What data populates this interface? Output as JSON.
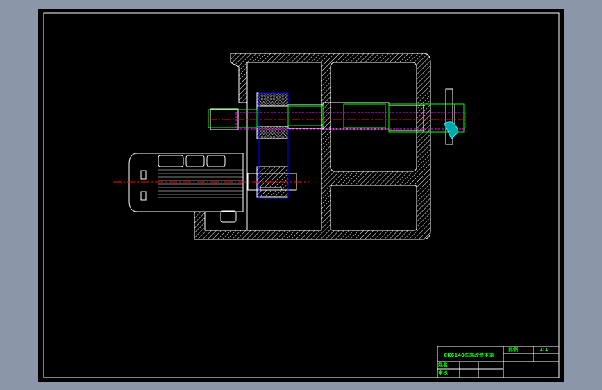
{
  "drawing": {
    "title": "CK6140车床改造主轴",
    "title_block": {
      "scale_label": "比例",
      "scale_value": "1:1",
      "name_label": "姓名",
      "review_label": "审核"
    }
  },
  "colors": {
    "background": "#000000",
    "outline": "#ffffff",
    "shaft": "#00ff00",
    "centerline": "#ff0000",
    "hidden": "#ff00ff",
    "gear_box": "#0000ff"
  }
}
